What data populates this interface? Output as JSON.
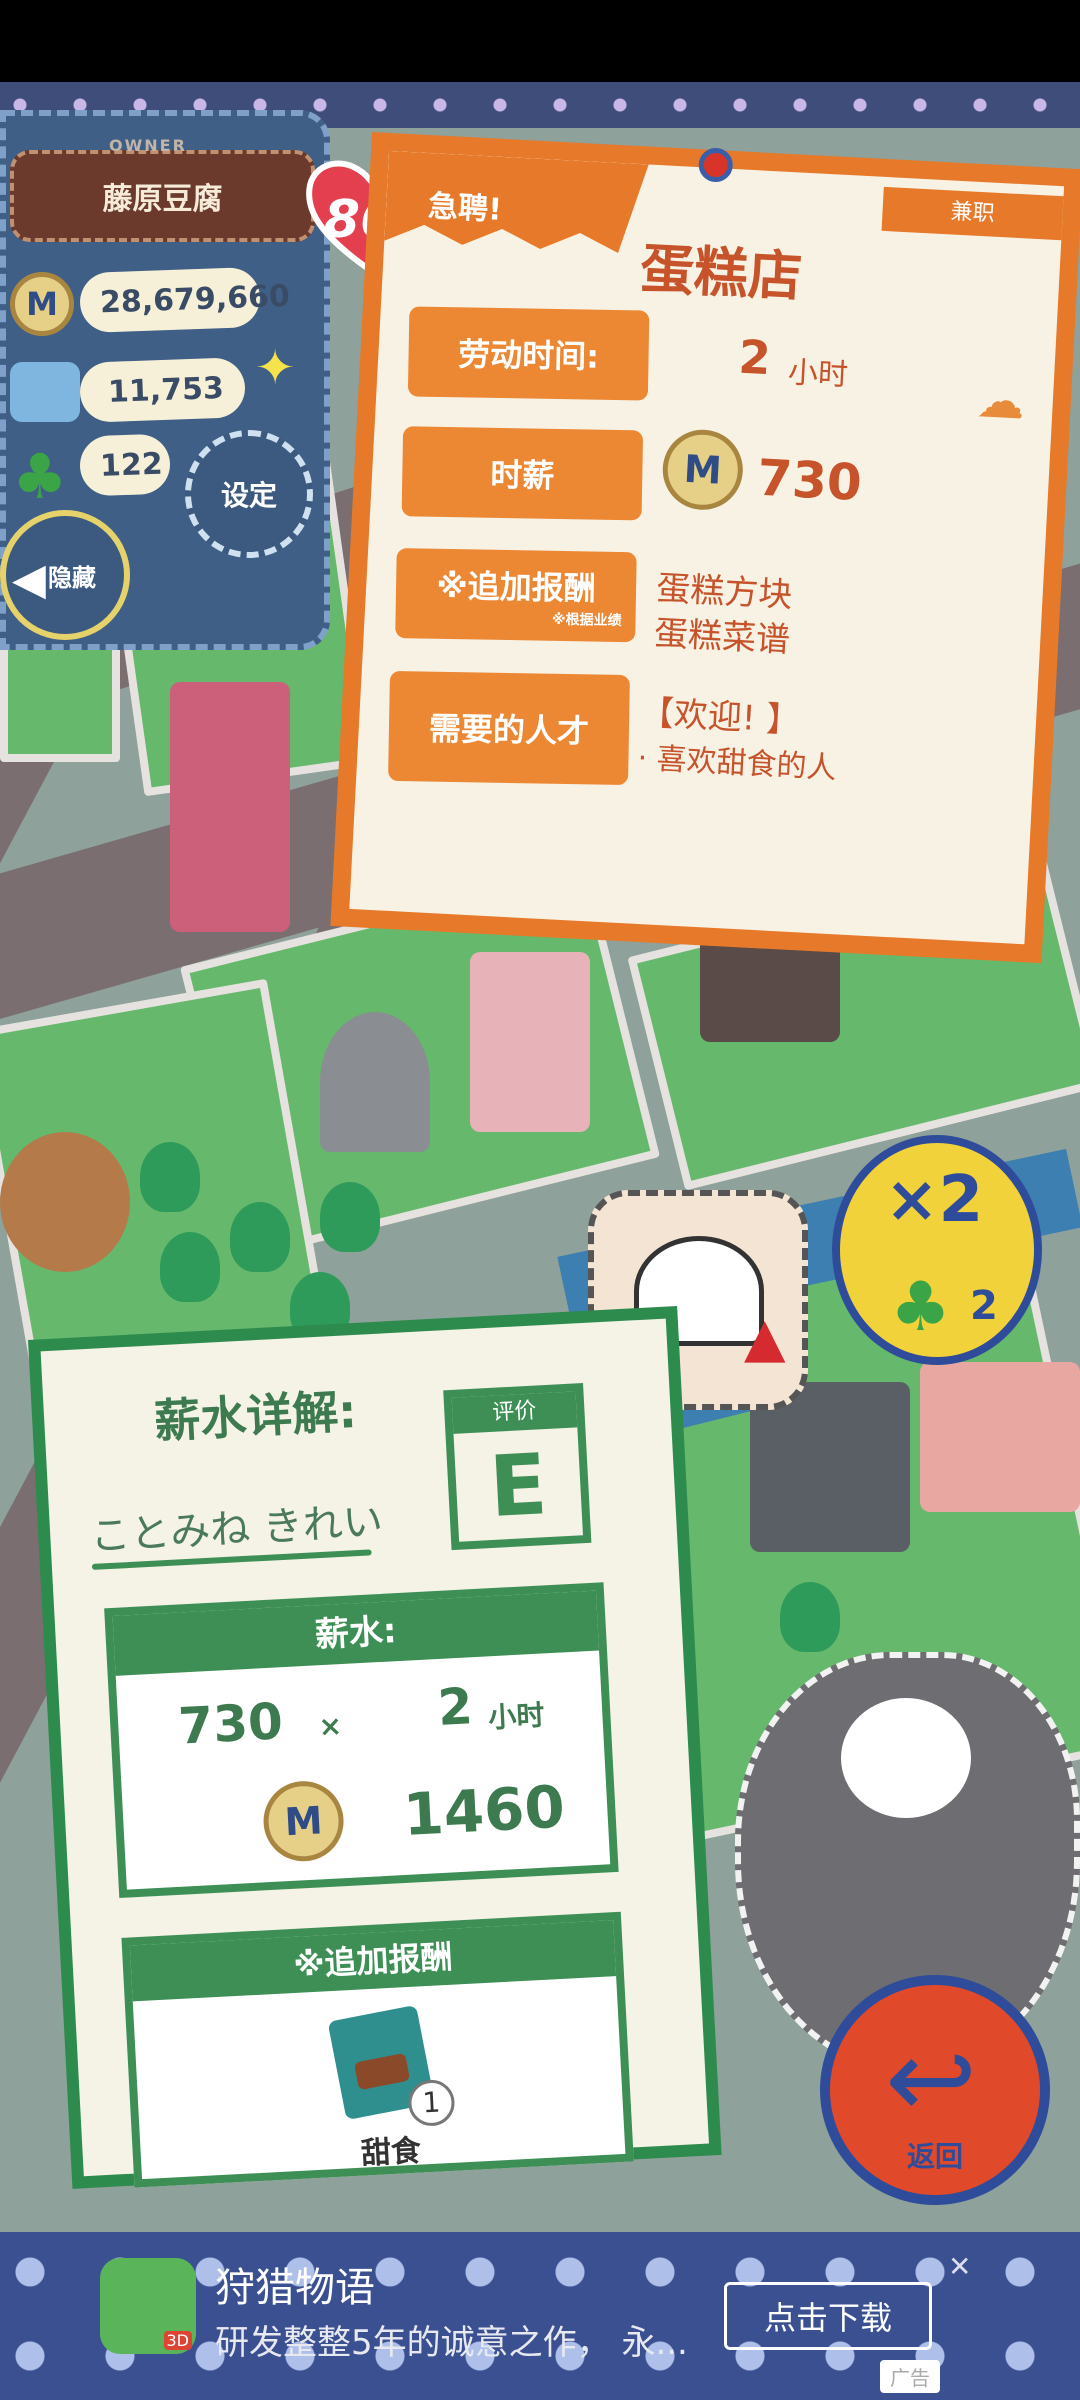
{
  "owner": {
    "tag_top": "OWNER",
    "name": "藤原豆腐",
    "level": "86",
    "money": "28,679,660",
    "points": "11,753",
    "clovers": "122",
    "settings_label": "设定",
    "hide_label": "隐藏"
  },
  "job": {
    "banner": "急聘!",
    "tag": "兼职",
    "shop_name": "蛋糕店",
    "work_time_label": "劳动时间:",
    "work_hours": "2",
    "hours_unit": "小时",
    "hourly_wage_label": "时薪",
    "hourly_wage": "730",
    "bonus_label": "※追加报酬",
    "bonus_note": "※根据业绩",
    "bonus_items": [
      "蛋糕方块",
      "蛋糕菜谱"
    ],
    "talent_label": "需要的人才",
    "talent_welcome": "【欢迎! 】",
    "talent_desc": "· 喜欢甜食的人"
  },
  "salary": {
    "title": "薪水详解:",
    "signature": "ことみね きれい",
    "grade_label": "评价",
    "grade": "E",
    "pay_head": "薪水:",
    "rate": "730",
    "times": "×",
    "hours": "2",
    "hours_unit": "小时",
    "total": "1460",
    "bonus_head": "※追加报酬",
    "bonus_count": "1",
    "bonus_item": "甜食"
  },
  "bubble": {
    "multiplier": "×2",
    "clover_count": "2"
  },
  "return_label": "返回",
  "coin_symbol": "M",
  "ad": {
    "title": "狩猎物语",
    "description": "研发整整5年的诚意之作，  永...",
    "cta": "点击下载",
    "close": "✕",
    "badge": "广告",
    "icon_tag": "3D"
  },
  "colors": {
    "accent_orange": "#e67a2a",
    "accent_green": "#3d8f55",
    "navy": "#2f4c9a",
    "return_red": "#e04a2a"
  }
}
